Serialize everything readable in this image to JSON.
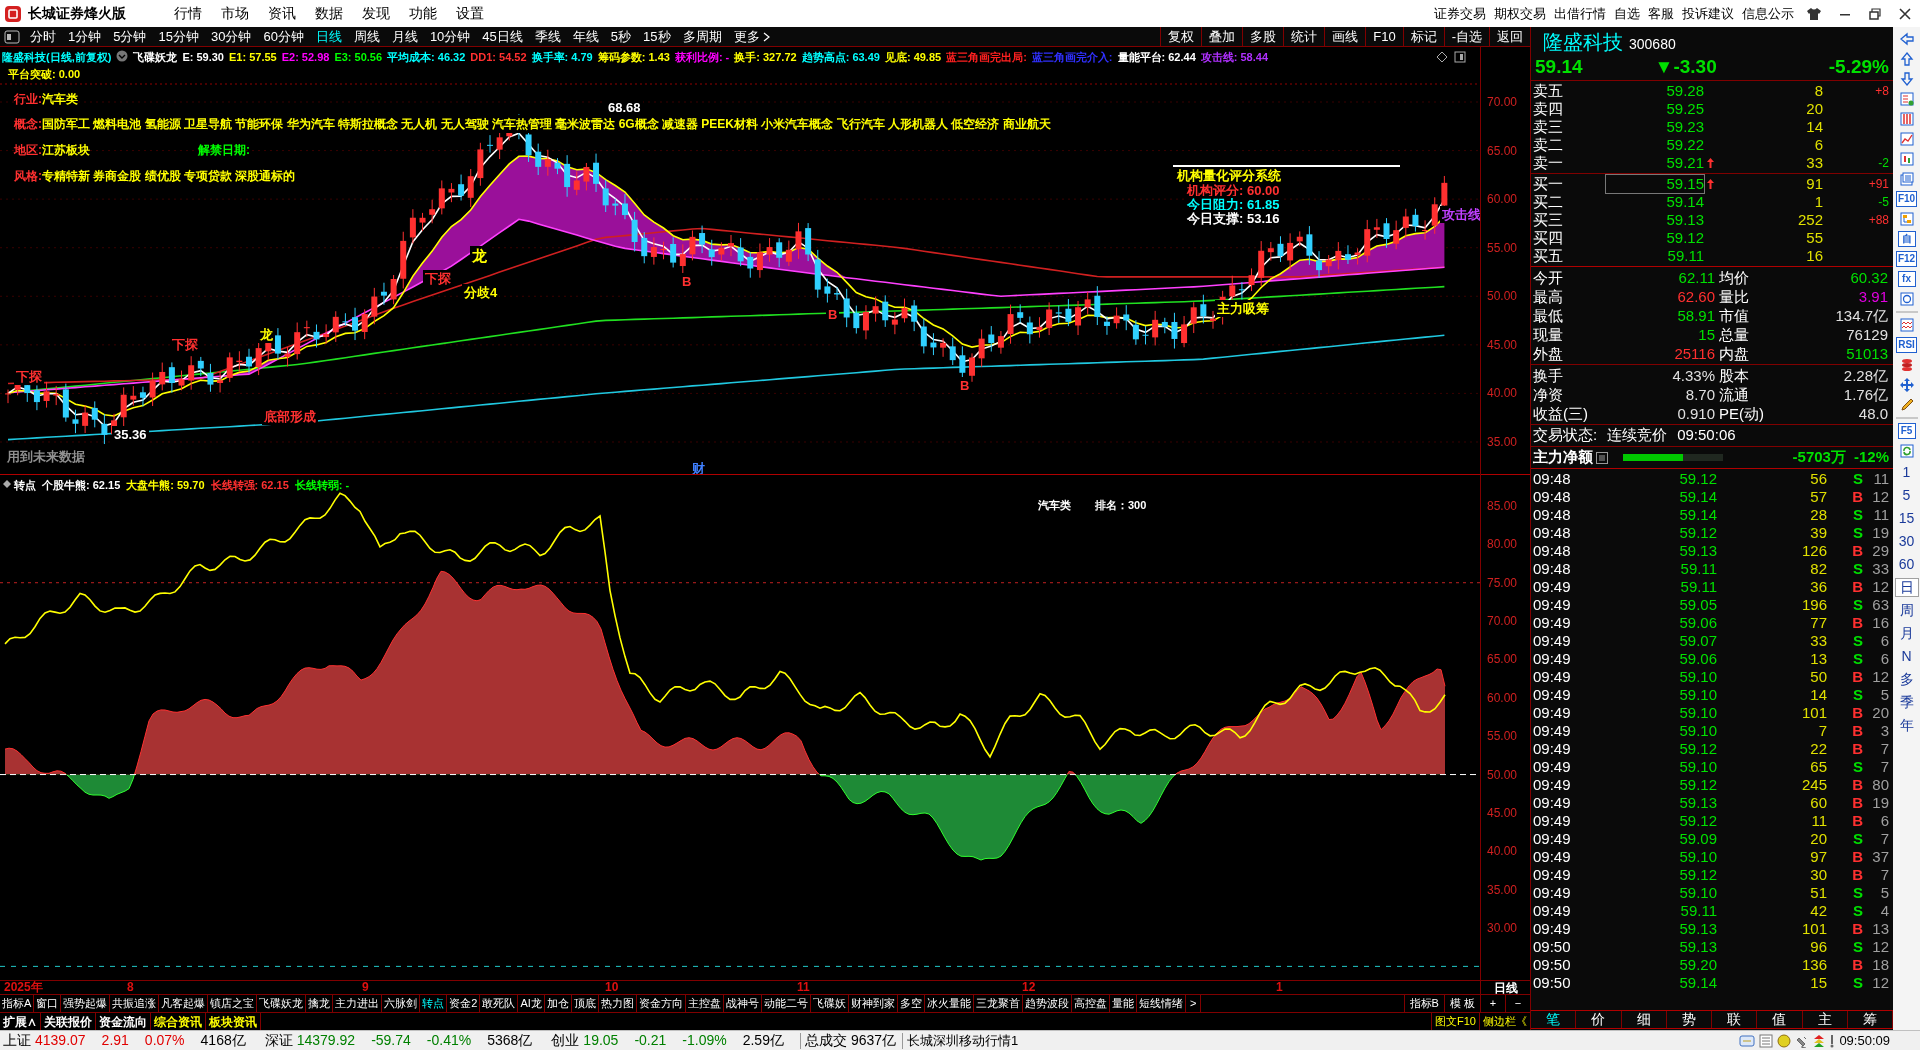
{
  "app": {
    "title": "长城证券烽火版",
    "menu": [
      "行情",
      "市场",
      "资讯",
      "数据",
      "发现",
      "功能",
      "设置"
    ],
    "links": [
      "证券交易",
      "期权交易",
      "出借行情",
      "自选",
      "客服",
      "投诉建议",
      "信息公示"
    ]
  },
  "periods": [
    {
      "label": "分时",
      "selected": false
    },
    {
      "label": "1分钟",
      "selected": false
    },
    {
      "label": "5分钟",
      "selected": false
    },
    {
      "label": "15分钟",
      "selected": false
    },
    {
      "label": "30分钟",
      "selected": false
    },
    {
      "label": "60分钟",
      "selected": false
    },
    {
      "label": "日线",
      "selected": true
    },
    {
      "label": "周线",
      "selected": false
    },
    {
      "label": "月线",
      "selected": false
    },
    {
      "label": "10分钟",
      "selected": false
    },
    {
      "label": "45日线",
      "selected": false
    },
    {
      "label": "季线",
      "selected": false
    },
    {
      "label": "年线",
      "selected": false
    },
    {
      "label": "5秒",
      "selected": false
    },
    {
      "label": "15秒",
      "selected": false
    },
    {
      "label": "多周期",
      "selected": false
    },
    {
      "label": "更多",
      "selected": false
    }
  ],
  "toolbar": [
    "复权",
    "叠加",
    "多股",
    "统计",
    "画线",
    "F10",
    "标记",
    "-自选",
    "返回"
  ],
  "legend": [
    {
      "text": "隆盛科技(日线,前复权)",
      "color": "#00ffff"
    },
    {
      "text": "飞碟妖龙",
      "color": "#ffffff"
    },
    {
      "text": "E: 59.30",
      "color": "#ffffff"
    },
    {
      "text": "E1: 57.55",
      "color": "#ffff00"
    },
    {
      "text": "E2: 52.98",
      "color": "#ff00ff"
    },
    {
      "text": "E3: 50.56",
      "color": "#00ff00"
    },
    {
      "text": "平均成本: 46.32",
      "color": "#00ffff"
    },
    {
      "text": "DD1: 54.52",
      "color": "#ff3030"
    },
    {
      "text": "换手率: 4.79",
      "color": "#00ffff"
    },
    {
      "text": "筹码参数: 1.43",
      "color": "#ffff00"
    },
    {
      "text": "获利比例: -",
      "color": "#ff00ff"
    },
    {
      "text": "换手: 327.72",
      "color": "#ffff00"
    },
    {
      "text": "趋势高点: 63.49",
      "color": "#00ffff"
    },
    {
      "text": "见底: 49.85",
      "color": "#ffff00"
    },
    {
      "text": "蓝三角画完出局:",
      "color": "#ff2020"
    },
    {
      "text": "蓝三角画完介入:",
      "color": "#3030ff"
    },
    {
      "text": "量能平台: 62.44",
      "color": "#ffffff"
    },
    {
      "text": "攻击线: 58.44",
      "color": "#b030ff"
    }
  ],
  "legend_line2": "平台突破: 0.00",
  "info_lines": [
    {
      "label": "行业:",
      "value": "汽车类"
    },
    {
      "label": "概念:",
      "value": "国防军工 燃料电池 氢能源 卫星导航 节能环保 华为汽车 特斯拉概念 无人机 无人驾驶 汽车热管理 毫米波雷达 6G概念 减速器 PEEK材料 小米汽车概念 飞行汽车 人形机器人 低空经济 商业航天"
    },
    {
      "label": "地区:",
      "value": "江苏板块",
      "extra": "解禁日期:"
    },
    {
      "label": "风格:",
      "value": "专精特新 券商金股 绩优股 专项贷款 深股通标的"
    }
  ],
  "chart_labels": [
    {
      "text": "68.68",
      "color": "#ffffff"
    },
    {
      "text": "35.36",
      "color": "#ffffff"
    },
    {
      "text": "下探",
      "color": "#ff3030"
    },
    {
      "text": "下探",
      "color": "#ff3030"
    },
    {
      "text": "下探",
      "color": "#ff3030"
    },
    {
      "text": "龙",
      "color": "#ffff00"
    },
    {
      "text": "龙",
      "color": "#ffff00"
    },
    {
      "text": "分歧4",
      "color": "#ffff00"
    },
    {
      "text": "底部形成",
      "color": "#ff3030"
    },
    {
      "text": "机构量化评分系统",
      "color": "#ffff00"
    },
    {
      "text": "机构评分: 60.00",
      "color": "#ff3030"
    },
    {
      "text": "今日阻力: 61.85",
      "color": "#00ffff"
    },
    {
      "text": "今日支撑: 53.16",
      "color": "#ffffff"
    },
    {
      "text": "主力吸筹",
      "color": "#ffff00"
    },
    {
      "text": "攻击线",
      "color": "#c040ff"
    },
    {
      "text": "B",
      "color": "#ff3030"
    },
    {
      "text": "B",
      "color": "#ff3030"
    },
    {
      "text": "B",
      "color": "#ff3030"
    },
    {
      "text": "用到未来数据",
      "color": "#909090"
    },
    {
      "text": "财",
      "color": "#4080ff"
    }
  ],
  "price_axis": [
    "70.00",
    "65.00",
    "60.00",
    "55.00",
    "50.00",
    "45.00",
    "40.00",
    "35.00"
  ],
  "indicator": {
    "legend": [
      {
        "text": "转点",
        "color": "#ffffff"
      },
      {
        "text": "个股牛熊: 62.15",
        "color": "#ffffff"
      },
      {
        "text": "大盘牛熊: 59.70",
        "color": "#ffff00"
      },
      {
        "text": "长线转强: 62.15",
        "color": "#ff3030"
      },
      {
        "text": "长线转弱: -",
        "color": "#00ff00"
      }
    ],
    "caption": "汽车类",
    "rank": "排名：300",
    "axis": [
      "85.00",
      "80.00",
      "75.00",
      "70.00",
      "65.00",
      "60.00",
      "55.00",
      "50.00",
      "45.00",
      "40.00",
      "35.00",
      "30.00"
    ]
  },
  "x_axis": [
    "2025年",
    "8",
    "9",
    "10",
    "11",
    "12",
    "1"
  ],
  "period_label": "日线",
  "indicator_tabs": [
    {
      "label": "指标A",
      "selected": false
    },
    {
      "label": "窗口",
      "selected": false
    },
    {
      "label": "强势起爆",
      "selected": false
    },
    {
      "label": "共振追涨",
      "selected": false
    },
    {
      "label": "凡客起爆",
      "selected": false
    },
    {
      "label": "镇店之宝",
      "selected": false
    },
    {
      "label": "飞碟妖龙",
      "selected": false
    },
    {
      "label": "擒龙",
      "selected": false
    },
    {
      "label": "主力进出",
      "selected": false
    },
    {
      "label": "六脉剑",
      "selected": false
    },
    {
      "label": "转点",
      "selected": true
    },
    {
      "label": "资金2",
      "selected": false
    },
    {
      "label": "敢死队",
      "selected": false
    },
    {
      "label": "AI龙",
      "selected": false
    },
    {
      "label": "加仓",
      "selected": false
    },
    {
      "label": "顶底",
      "selected": false
    },
    {
      "label": "热力图",
      "selected": false
    },
    {
      "label": "资金方向",
      "selected": false
    },
    {
      "label": "主控盘",
      "selected": false
    },
    {
      "label": "战神号",
      "selected": false
    },
    {
      "label": "动能二号",
      "selected": false
    },
    {
      "label": "飞碟妖",
      "selected": false
    },
    {
      "label": "财神到家",
      "selected": false
    },
    {
      "label": "多空",
      "selected": false
    },
    {
      "label": "冰火量能",
      "selected": false
    },
    {
      "label": "三龙聚首",
      "selected": false
    },
    {
      "label": "趋势波段",
      "selected": false
    },
    {
      "label": "高控盘",
      "selected": false
    },
    {
      "label": "量能",
      "selected": false
    },
    {
      "label": "短线情绪",
      "selected": false
    }
  ],
  "tab_more": ">",
  "right_tabs": [
    "指标B",
    "模 板"
  ],
  "zoom_buttons": [
    "+",
    "−"
  ],
  "bottom_tabs": [
    {
      "label": "扩展∧",
      "color": "#ffffff"
    },
    {
      "label": "关联报价",
      "color": "#ffffff"
    },
    {
      "label": "资金流向",
      "color": "#ffffff"
    },
    {
      "label": "综合资讯",
      "color": "#ffff00"
    },
    {
      "label": "板块资讯",
      "color": "#ffff00"
    }
  ],
  "side_links": [
    "图文F10",
    "侧边栏《"
  ],
  "quote": {
    "name": "隆盛科技",
    "code": "300680",
    "price": "59.14",
    "change": "▼-3.30",
    "pct": "-5.29%"
  },
  "order_book": [
    {
      "label": "卖五",
      "price": "59.28",
      "volume": "8",
      "delta": "+8",
      "up_arrow": false,
      "selected": false
    },
    {
      "label": "卖四",
      "price": "59.25",
      "volume": "20",
      "up_arrow": false,
      "selected": false
    },
    {
      "label": "卖三",
      "price": "59.23",
      "volume": "14",
      "up_arrow": false,
      "selected": false
    },
    {
      "label": "卖二",
      "price": "59.22",
      "volume": "6",
      "up_arrow": false,
      "selected": false
    },
    {
      "label": "卖一",
      "price": "59.21",
      "volume": "33",
      "delta": "-2",
      "up_arrow": true,
      "selected": false
    },
    {
      "label": "买一",
      "price": "59.15",
      "volume": "91",
      "delta": "+91",
      "up_arrow": true,
      "selected": true
    },
    {
      "label": "买二",
      "price": "59.14",
      "volume": "1",
      "delta": "-5",
      "up_arrow": false,
      "selected": false
    },
    {
      "label": "买三",
      "price": "59.13",
      "volume": "252",
      "delta": "+88",
      "up_arrow": false,
      "selected": false
    },
    {
      "label": "买四",
      "price": "59.12",
      "volume": "55",
      "up_arrow": false,
      "selected": false
    },
    {
      "label": "买五",
      "price": "59.11",
      "volume": "16",
      "up_arrow": false,
      "selected": false
    }
  ],
  "stats": [
    {
      "left": {
        "label": "今开",
        "value": "62.11",
        "color": "#00e000"
      },
      "right": {
        "label": "均价",
        "value": "60.32",
        "color": "#00e000"
      }
    },
    {
      "left": {
        "label": "最高",
        "value": "62.60",
        "color": "#ff3030"
      },
      "right": {
        "label": "量比",
        "value": "3.91",
        "color": "#e000e0"
      }
    },
    {
      "left": {
        "label": "最低",
        "value": "58.91",
        "color": "#00e000"
      },
      "right": {
        "label": "市值",
        "value": "134.7亿",
        "color": "#e0e0e0"
      }
    },
    {
      "left": {
        "label": "现量",
        "value": "15",
        "color": "#00e000"
      },
      "right": {
        "label": "总量",
        "value": "76129",
        "color": "#e0e0e0"
      }
    },
    {
      "left": {
        "label": "外盘",
        "value": "25116",
        "color": "#ff3030"
      },
      "right": {
        "label": "内盘",
        "value": "51013",
        "color": "#00e000"
      }
    }
  ],
  "fundamentals": [
    {
      "left": {
        "label": "换手",
        "value": "4.33%"
      },
      "right": {
        "label": "股本",
        "value": "2.28亿"
      }
    },
    {
      "left": {
        "label": "净资",
        "value": "8.70"
      },
      "right": {
        "label": "流通",
        "value": "1.76亿"
      }
    },
    {
      "left": {
        "label": "收益(三)",
        "value": "0.910"
      },
      "right": {
        "label": "PE(动)",
        "value": "48.0"
      }
    }
  ],
  "trade_status": {
    "label": "交易状态:",
    "value": "连续竞价",
    "time": "09:50:06"
  },
  "main_flow": {
    "label": "主力净额",
    "level": 0.6,
    "amount": "-5703万",
    "pct": "-12%"
  },
  "ticks": [
    {
      "time": "09:48",
      "price": "59.12",
      "volume": "56",
      "side": "S",
      "kind": "sell",
      "count": "11"
    },
    {
      "time": "09:48",
      "price": "59.14",
      "volume": "57",
      "side": "B",
      "kind": "buy",
      "count": "12"
    },
    {
      "time": "09:48",
      "price": "59.14",
      "volume": "28",
      "side": "S",
      "kind": "sell",
      "count": "11"
    },
    {
      "time": "09:48",
      "price": "59.12",
      "volume": "39",
      "side": "S",
      "kind": "sell",
      "count": "19"
    },
    {
      "time": "09:48",
      "price": "59.13",
      "volume": "126",
      "side": "B",
      "kind": "buy",
      "count": "29"
    },
    {
      "time": "09:48",
      "price": "59.11",
      "volume": "82",
      "side": "S",
      "kind": "sell",
      "count": "33"
    },
    {
      "time": "09:49",
      "price": "59.11",
      "volume": "36",
      "side": "B",
      "kind": "buy",
      "count": "12"
    },
    {
      "time": "09:49",
      "price": "59.05",
      "volume": "196",
      "side": "S",
      "kind": "sell",
      "count": "63"
    },
    {
      "time": "09:49",
      "price": "59.06",
      "volume": "77",
      "side": "B",
      "kind": "buy",
      "count": "16"
    },
    {
      "time": "09:49",
      "price": "59.07",
      "volume": "33",
      "side": "S",
      "kind": "sell",
      "count": "6"
    },
    {
      "time": "09:49",
      "price": "59.06",
      "volume": "13",
      "side": "S",
      "kind": "sell",
      "count": "6"
    },
    {
      "time": "09:49",
      "price": "59.10",
      "volume": "50",
      "side": "B",
      "kind": "buy",
      "count": "12"
    },
    {
      "time": "09:49",
      "price": "59.10",
      "volume": "14",
      "side": "S",
      "kind": "sell",
      "count": "5"
    },
    {
      "time": "09:49",
      "price": "59.10",
      "volume": "101",
      "side": "B",
      "kind": "buy",
      "count": "20"
    },
    {
      "time": "09:49",
      "price": "59.10",
      "volume": "7",
      "side": "B",
      "kind": "buy",
      "count": "3"
    },
    {
      "time": "09:49",
      "price": "59.12",
      "volume": "22",
      "side": "B",
      "kind": "buy",
      "count": "7"
    },
    {
      "time": "09:49",
      "price": "59.10",
      "volume": "65",
      "side": "S",
      "kind": "sell",
      "count": "7"
    },
    {
      "time": "09:49",
      "price": "59.12",
      "volume": "245",
      "side": "B",
      "kind": "buy",
      "count": "80"
    },
    {
      "time": "09:49",
      "price": "59.13",
      "volume": "60",
      "side": "B",
      "kind": "buy",
      "count": "19"
    },
    {
      "time": "09:49",
      "price": "59.12",
      "volume": "11",
      "side": "B",
      "kind": "buy",
      "count": "6"
    },
    {
      "time": "09:49",
      "price": "59.09",
      "volume": "20",
      "side": "S",
      "kind": "sell",
      "count": "7"
    },
    {
      "time": "09:49",
      "price": "59.10",
      "volume": "97",
      "side": "B",
      "kind": "buy",
      "count": "37"
    },
    {
      "time": "09:49",
      "price": "59.12",
      "volume": "30",
      "side": "B",
      "kind": "buy",
      "count": "7"
    },
    {
      "time": "09:49",
      "price": "59.10",
      "volume": "51",
      "side": "S",
      "kind": "sell",
      "count": "5"
    },
    {
      "time": "09:49",
      "price": "59.11",
      "volume": "42",
      "side": "S",
      "kind": "sell",
      "count": "4"
    },
    {
      "time": "09:49",
      "price": "59.13",
      "volume": "101",
      "side": "B",
      "kind": "buy",
      "count": "13"
    },
    {
      "time": "09:50",
      "price": "59.13",
      "volume": "96",
      "side": "S",
      "kind": "sell",
      "count": "12"
    },
    {
      "time": "09:50",
      "price": "59.20",
      "volume": "136",
      "side": "B",
      "kind": "buy",
      "count": "18"
    },
    {
      "time": "09:50",
      "price": "59.14",
      "volume": "15",
      "side": "S",
      "kind": "sell",
      "count": "12"
    }
  ],
  "detail_tabs": [
    {
      "label": "笔",
      "selected": true
    },
    {
      "label": "价",
      "selected": false
    },
    {
      "label": "细",
      "selected": false
    },
    {
      "label": "势",
      "selected": false
    },
    {
      "label": "联",
      "selected": false
    },
    {
      "label": "值",
      "selected": false
    },
    {
      "label": "主",
      "selected": false
    },
    {
      "label": "筹",
      "selected": false
    }
  ],
  "sidebar_labels": [
    "F10",
    "自",
    "F12",
    "fx",
    "RSI",
    "F5"
  ],
  "sidebar_periods": [
    {
      "label": "1",
      "selected": false
    },
    {
      "label": "5",
      "selected": false
    },
    {
      "label": "15",
      "selected": false
    },
    {
      "label": "30",
      "selected": false
    },
    {
      "label": "60",
      "selected": false
    },
    {
      "label": "日",
      "selected": true
    },
    {
      "label": "周",
      "selected": false
    },
    {
      "label": "月",
      "selected": false
    },
    {
      "label": "N",
      "selected": false
    },
    {
      "label": "多",
      "selected": false
    },
    {
      "label": "季",
      "selected": false
    },
    {
      "label": "年",
      "selected": false
    }
  ],
  "status_bar": {
    "markets": [
      {
        "name": "上证",
        "values": [
          {
            "text": "4139.07",
            "color": "#e00000"
          },
          {
            "text": "2.91",
            "color": "#e00000"
          },
          {
            "text": "0.07%",
            "color": "#e00000"
          },
          {
            "text": "4168亿",
            "color": "#000000"
          }
        ]
      },
      {
        "name": "深证",
        "values": [
          {
            "text": "14379.92",
            "color": "#008000"
          },
          {
            "text": "-59.74",
            "color": "#008000"
          },
          {
            "text": "-0.41%",
            "color": "#008000"
          },
          {
            "text": "5368亿",
            "color": "#000000"
          }
        ]
      },
      {
        "name": "创业",
        "values": [
          {
            "text": "19.05",
            "color": "#008000"
          },
          {
            "text": "-0.21",
            "color": "#008000"
          },
          {
            "text": "-1.09%",
            "color": "#008000"
          },
          {
            "text": "2.59亿",
            "color": "#000000"
          }
        ]
      }
    ],
    "total_label": "总成交",
    "total": "9637亿",
    "feed": "长城深圳移动行情1",
    "time": "09:50:09"
  }
}
